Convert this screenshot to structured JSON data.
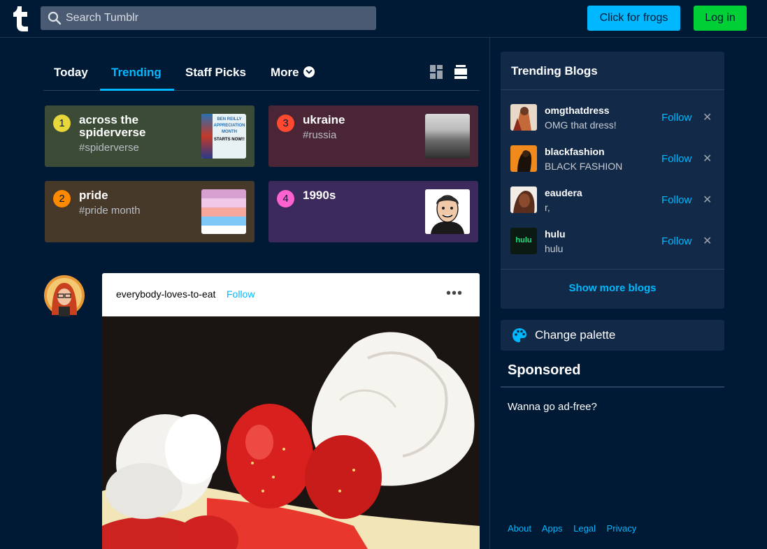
{
  "header": {
    "search_placeholder": "Search Tumblr",
    "frogs_label": "Click for frogs",
    "login_label": "Log in"
  },
  "tabs": {
    "today": "Today",
    "trending": "Trending",
    "staff_picks": "Staff Picks",
    "more": "More"
  },
  "trending": [
    {
      "rank": "1",
      "title": "across the spiderverse",
      "tag": "#spiderverse",
      "thumb_text": [
        "BEN REILLY",
        "APPRECIATION",
        "MONTH",
        "STARTS NOW!!"
      ]
    },
    {
      "rank": "2",
      "title": "pride",
      "tag": "#pride month"
    },
    {
      "rank": "3",
      "title": "ukraine",
      "tag": "#russia"
    },
    {
      "rank": "4",
      "title": "1990s",
      "tag": ""
    }
  ],
  "post": {
    "blog": "everybody-loves-to-eat",
    "follow": "Follow",
    "more": "•••"
  },
  "sidebar": {
    "trending_title": "Trending Blogs",
    "blogs": [
      {
        "name": "omgthatdress",
        "desc": "OMG that dress!",
        "follow": "Follow"
      },
      {
        "name": "blackfashion",
        "desc": "BLACK FASHION",
        "follow": "Follow"
      },
      {
        "name": "eaudera",
        "desc": "r,",
        "follow": "Follow"
      },
      {
        "name": "hulu",
        "desc": "hulu",
        "follow": "Follow",
        "logo_text": "hulu"
      }
    ],
    "show_more": "Show more blogs",
    "palette": "Change palette",
    "sponsored": "Sponsored",
    "adfree": "Wanna go ad-free?"
  },
  "footer": {
    "about": "About",
    "apps": "Apps",
    "legal": "Legal",
    "privacy": "Privacy"
  },
  "colors": {
    "background": "#001935",
    "accent": "#00b8ff",
    "login_green": "#00cf35",
    "panel": "#122a47"
  }
}
